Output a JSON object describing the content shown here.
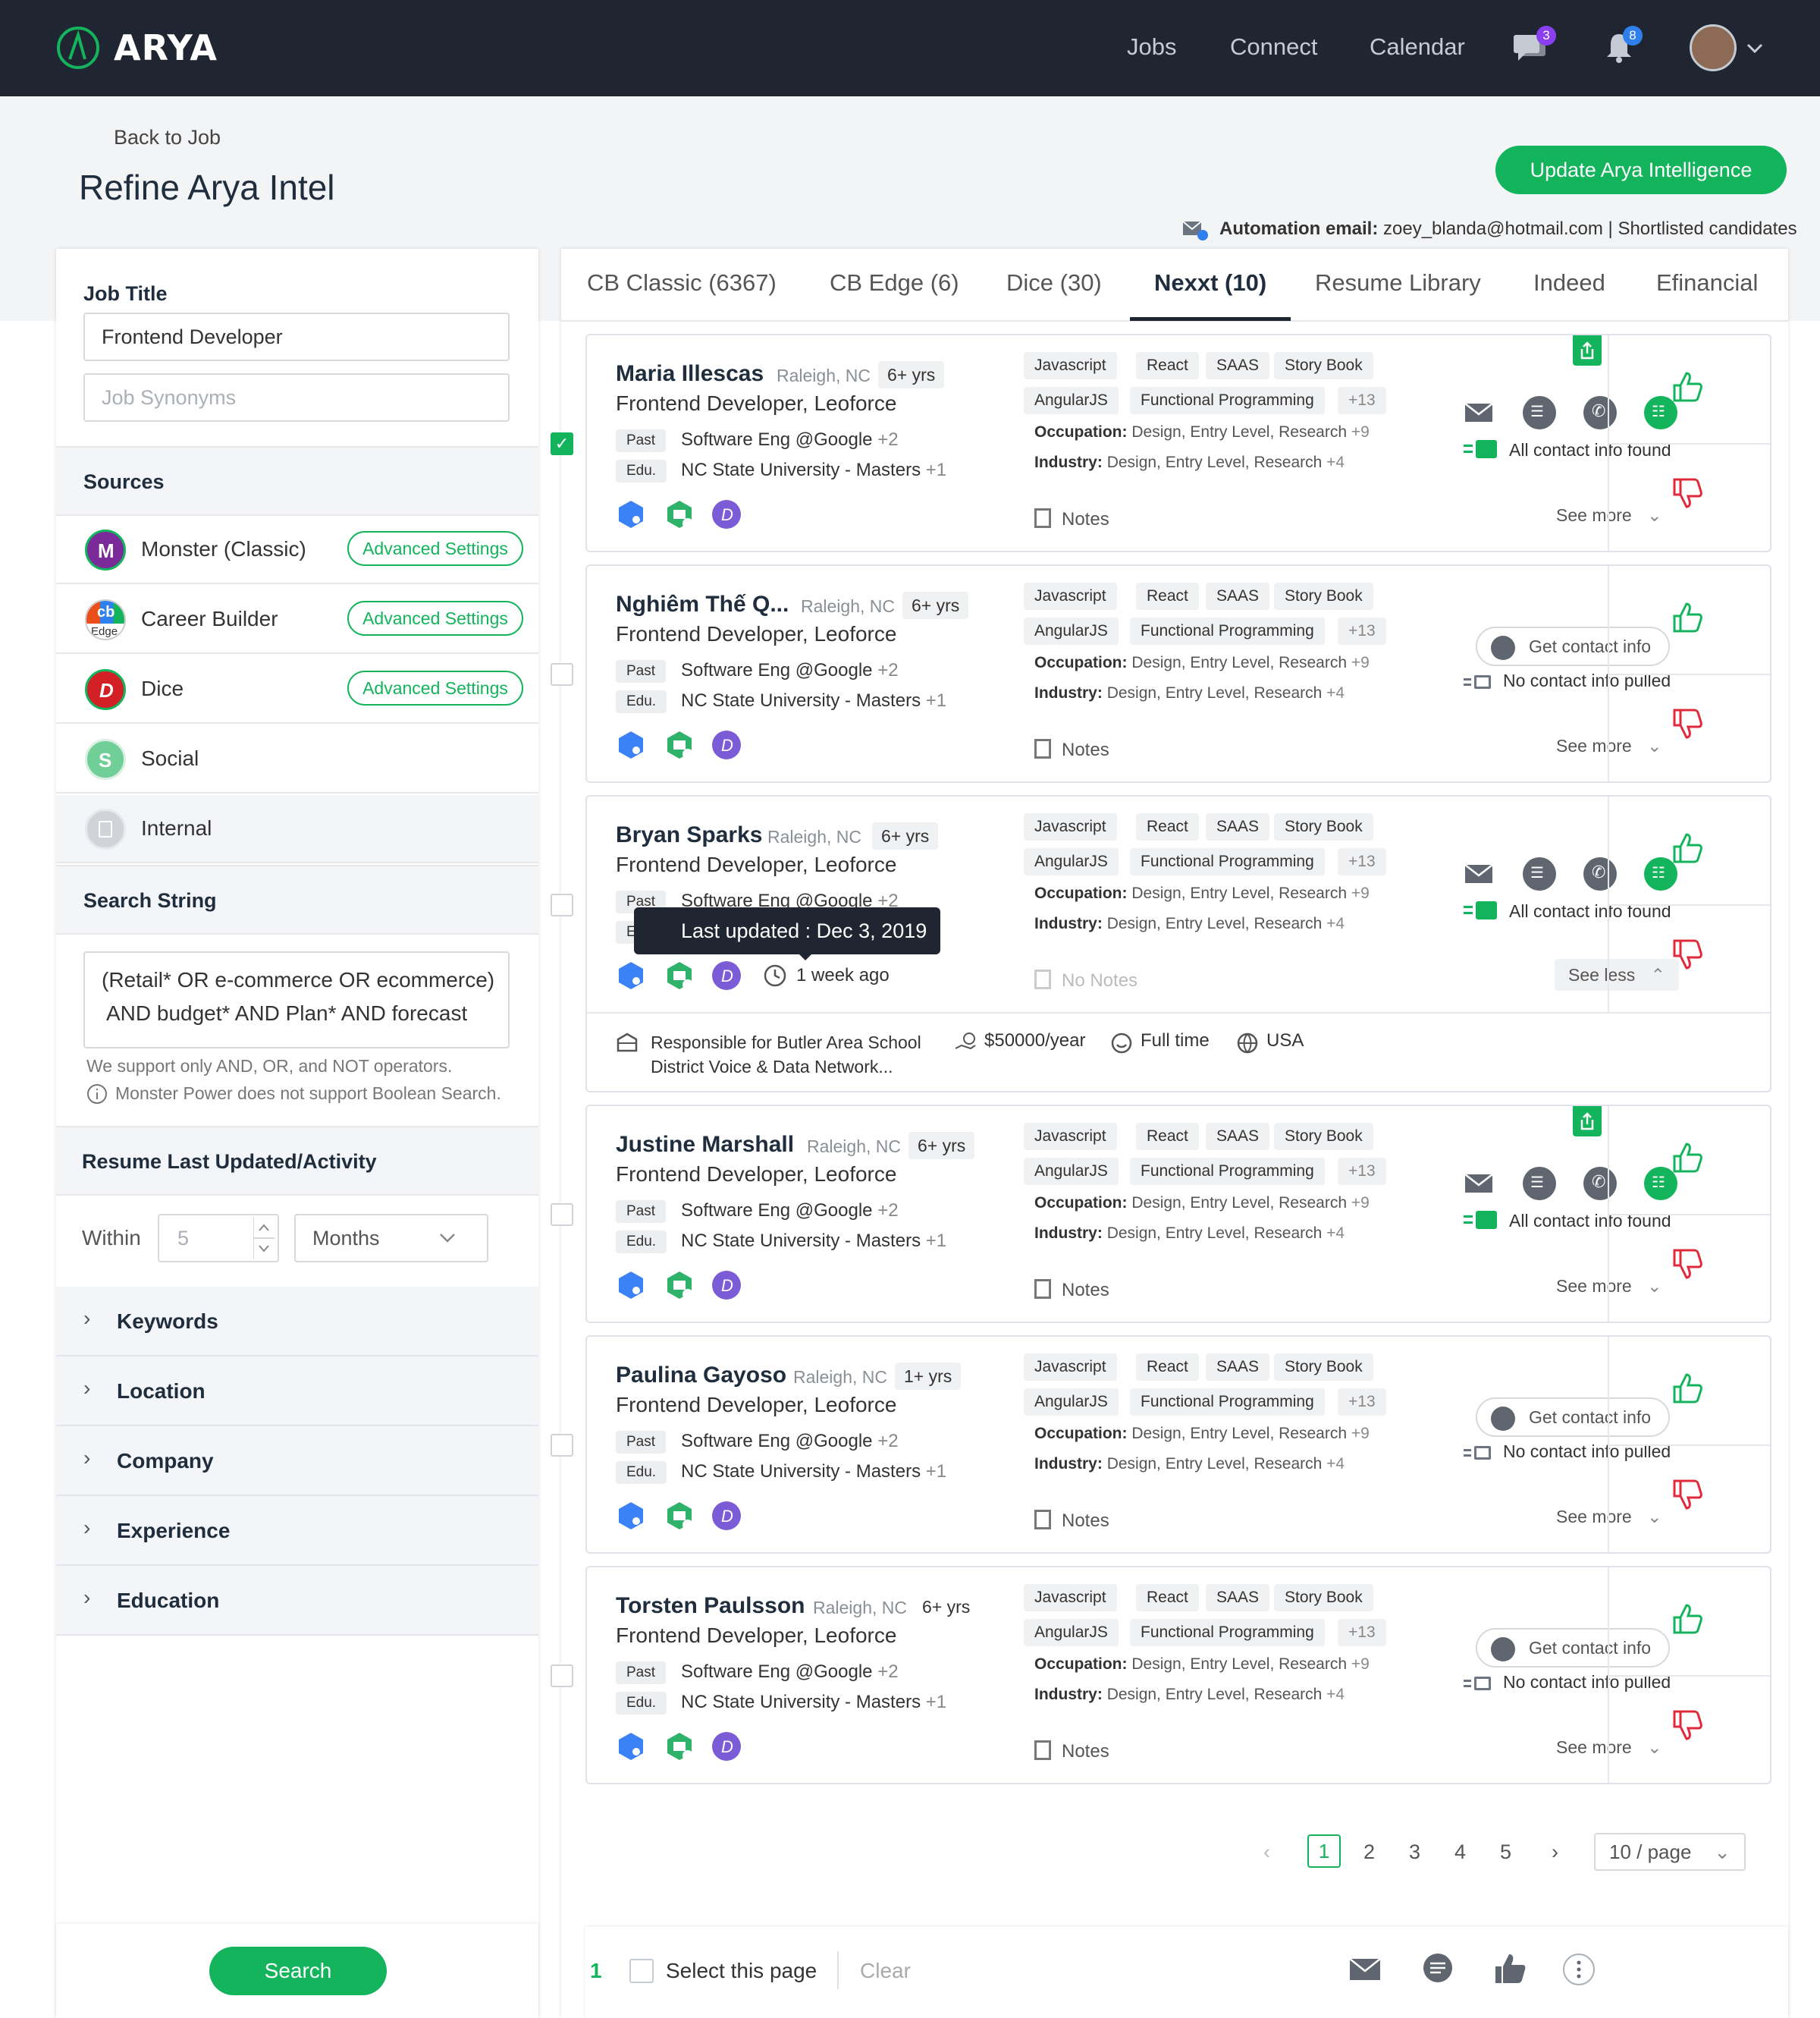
{
  "app": {
    "name": "ARYA"
  },
  "nav": {
    "jobs": "Jobs",
    "connect": "Connect",
    "calendar": "Calendar",
    "messages_count": "3",
    "notifications_count": "8"
  },
  "header": {
    "back": "Back to Job",
    "title": "Refine Arya Intel",
    "update_button": "Update Arya Intelligence",
    "automation_label": "Automation email:",
    "automation_value": "zoey_blanda@hotmail.com | Shortlisted candidates"
  },
  "left": {
    "job_title_label": "Job Title",
    "job_title_value": "Frontend Developer",
    "job_synonyms_placeholder": "Job Synonyms",
    "sources_label": "Sources",
    "sources": [
      {
        "name": "Monster (Classic)",
        "button": "Advanced Settings"
      },
      {
        "name": "Career Builder",
        "button": "Advanced Settings",
        "icon_text": "cb",
        "icon_sub": "Edge"
      },
      {
        "name": "Dice",
        "button": "Advanced Settings"
      },
      {
        "name": "Social"
      },
      {
        "name": "Internal"
      }
    ],
    "search_string_label": "Search String",
    "search_string_line1": "(Retail* OR e-commerce OR ecommerce)",
    "search_string_line2": "AND budget* AND Plan* AND forecast",
    "support_note": "We support only AND, OR, and NOT operators.",
    "monster_note": "Monster Power does not support Boolean Search.",
    "resume_label": "Resume Last Updated/Activity",
    "within_label": "Within",
    "within_value": "5",
    "within_unit": "Months",
    "sections": [
      "Keywords",
      "Location",
      "Company",
      "Experience",
      "Education"
    ],
    "search_button": "Search"
  },
  "tabs": [
    "CB Classic (6367)",
    "CB Edge (6)",
    "Dice (30)",
    "Nexxt (10)",
    "Resume Library",
    "Indeed",
    "Efinancial"
  ],
  "active_tab": "Nexxt (10)",
  "skills_row1": [
    "Javascript",
    "React",
    "SAAS",
    "Story Book"
  ],
  "skills_row2": [
    "AngularJS",
    "Functional Programming",
    "+13"
  ],
  "common": {
    "role": "Frontend Developer, Leoforce",
    "past_tag": "Past",
    "past_value": "Software Eng @Google",
    "past_more": "+2",
    "edu_tag": "Edu.",
    "edu_value": "NC State University - Masters",
    "edu_more": "+1",
    "occupation_label": "Occupation:",
    "occupation_value": "Design, Entry Level, Research",
    "occupation_more": "+9",
    "industry_label": "Industry:",
    "industry_value": "Design, Entry Level, Research",
    "industry_more": "+4",
    "notes": "Notes",
    "no_notes": "No Notes",
    "see_more": "See more",
    "see_less": "See less",
    "all_contact": "All contact info found",
    "no_contact": "No contact info pulled",
    "get_contact": "Get contact info"
  },
  "candidates": [
    {
      "name": "Maria Illescas",
      "location": "Raleigh, NC",
      "experience": "6+ yrs"
    },
    {
      "name": "Nghiêm Thế Q...",
      "location": "Raleigh, NC",
      "experience": "6+ yrs"
    },
    {
      "name": "Bryan Sparks",
      "location": "Raleigh, NC",
      "experience": "6+ yrs"
    },
    {
      "name": "Justine Marshall",
      "location": "Raleigh, NC",
      "experience": "6+ yrs"
    },
    {
      "name": "Paulina Gayoso",
      "location": "Raleigh, NC",
      "experience": "1+ yrs"
    },
    {
      "name": "Torsten Paulsson",
      "location": "Raleigh, NC",
      "experience": "6+ yrs"
    }
  ],
  "expanded": {
    "tooltip": "Last updated : Dec 3, 2019",
    "updated": "1 week ago",
    "summary_line1": "Responsible for Butler Area School",
    "summary_line2": "District Voice & Data Network...",
    "salary": "$50000/year",
    "job_type": "Full time",
    "country": "USA"
  },
  "pagination": {
    "pages": [
      "1",
      "2",
      "3",
      "4",
      "5"
    ],
    "current": "1",
    "page_size": "10 / page"
  },
  "footer": {
    "count": "1",
    "select_page": "Select this page",
    "clear": "Clear"
  },
  "colors": {
    "brand": "#13b45c",
    "topbar": "#1f2631",
    "badge": "#8a3ff0",
    "dislike": "#e0293b"
  }
}
